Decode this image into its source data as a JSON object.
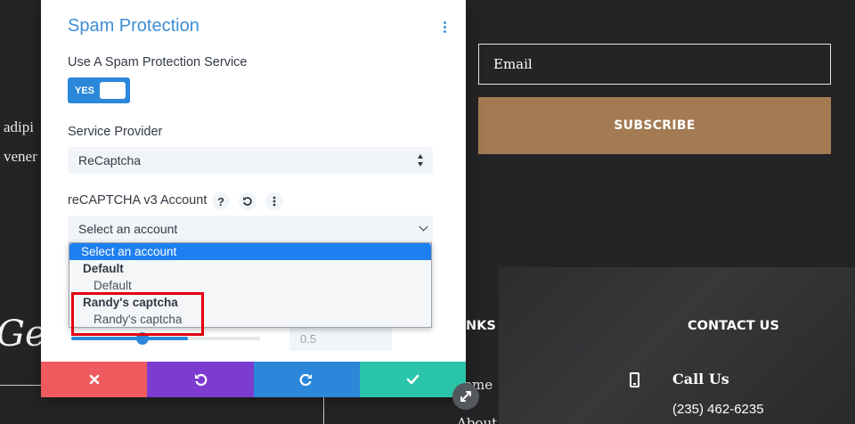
{
  "background": {
    "text_line_1": "adipi",
    "text_line_2": "vener",
    "heading_partial": "Get",
    "email_placeholder": "Email",
    "subscribe_label": "SUBSCRIBE",
    "links_heading_partial": "NKS",
    "contact_heading": "CONTACT US",
    "link_home_partial": "ome",
    "link_about_partial": "About",
    "call_us_title": "Call Us",
    "call_us_phone": "(235) 462-6235"
  },
  "panel": {
    "title": "Spam Protection",
    "use_service_label": "Use A Spam Protection Service",
    "toggle_label": "YES",
    "provider_label": "Service Provider",
    "provider_value": "ReCaptcha",
    "account_label": "reCAPTCHA v3 Account",
    "help_glyph": "?",
    "account_select_value": "Select an account",
    "slider_value": "0.5",
    "slider_fraction": 0.62,
    "dropdown": {
      "options": [
        {
          "type": "option",
          "label": "Select an account",
          "selected": true
        },
        {
          "type": "group",
          "label": "Default"
        },
        {
          "type": "option",
          "label": "Default"
        },
        {
          "type": "group",
          "label": "Randy's captcha"
        },
        {
          "type": "option",
          "label": "Randy's captcha"
        }
      ]
    }
  },
  "actionbar": {
    "cancel_icon": "close-icon",
    "undo_icon": "undo-icon",
    "redo_icon": "redo-icon",
    "save_icon": "check-icon"
  },
  "colors": {
    "accent_blue": "#2b87da",
    "title_blue": "#3e8ed6",
    "cancel_red": "#ef5a5e",
    "undo_purple": "#7e3bd0",
    "save_green": "#29c4a9",
    "subscribe_brown": "#a37a52",
    "highlight_red": "#e3000f"
  }
}
